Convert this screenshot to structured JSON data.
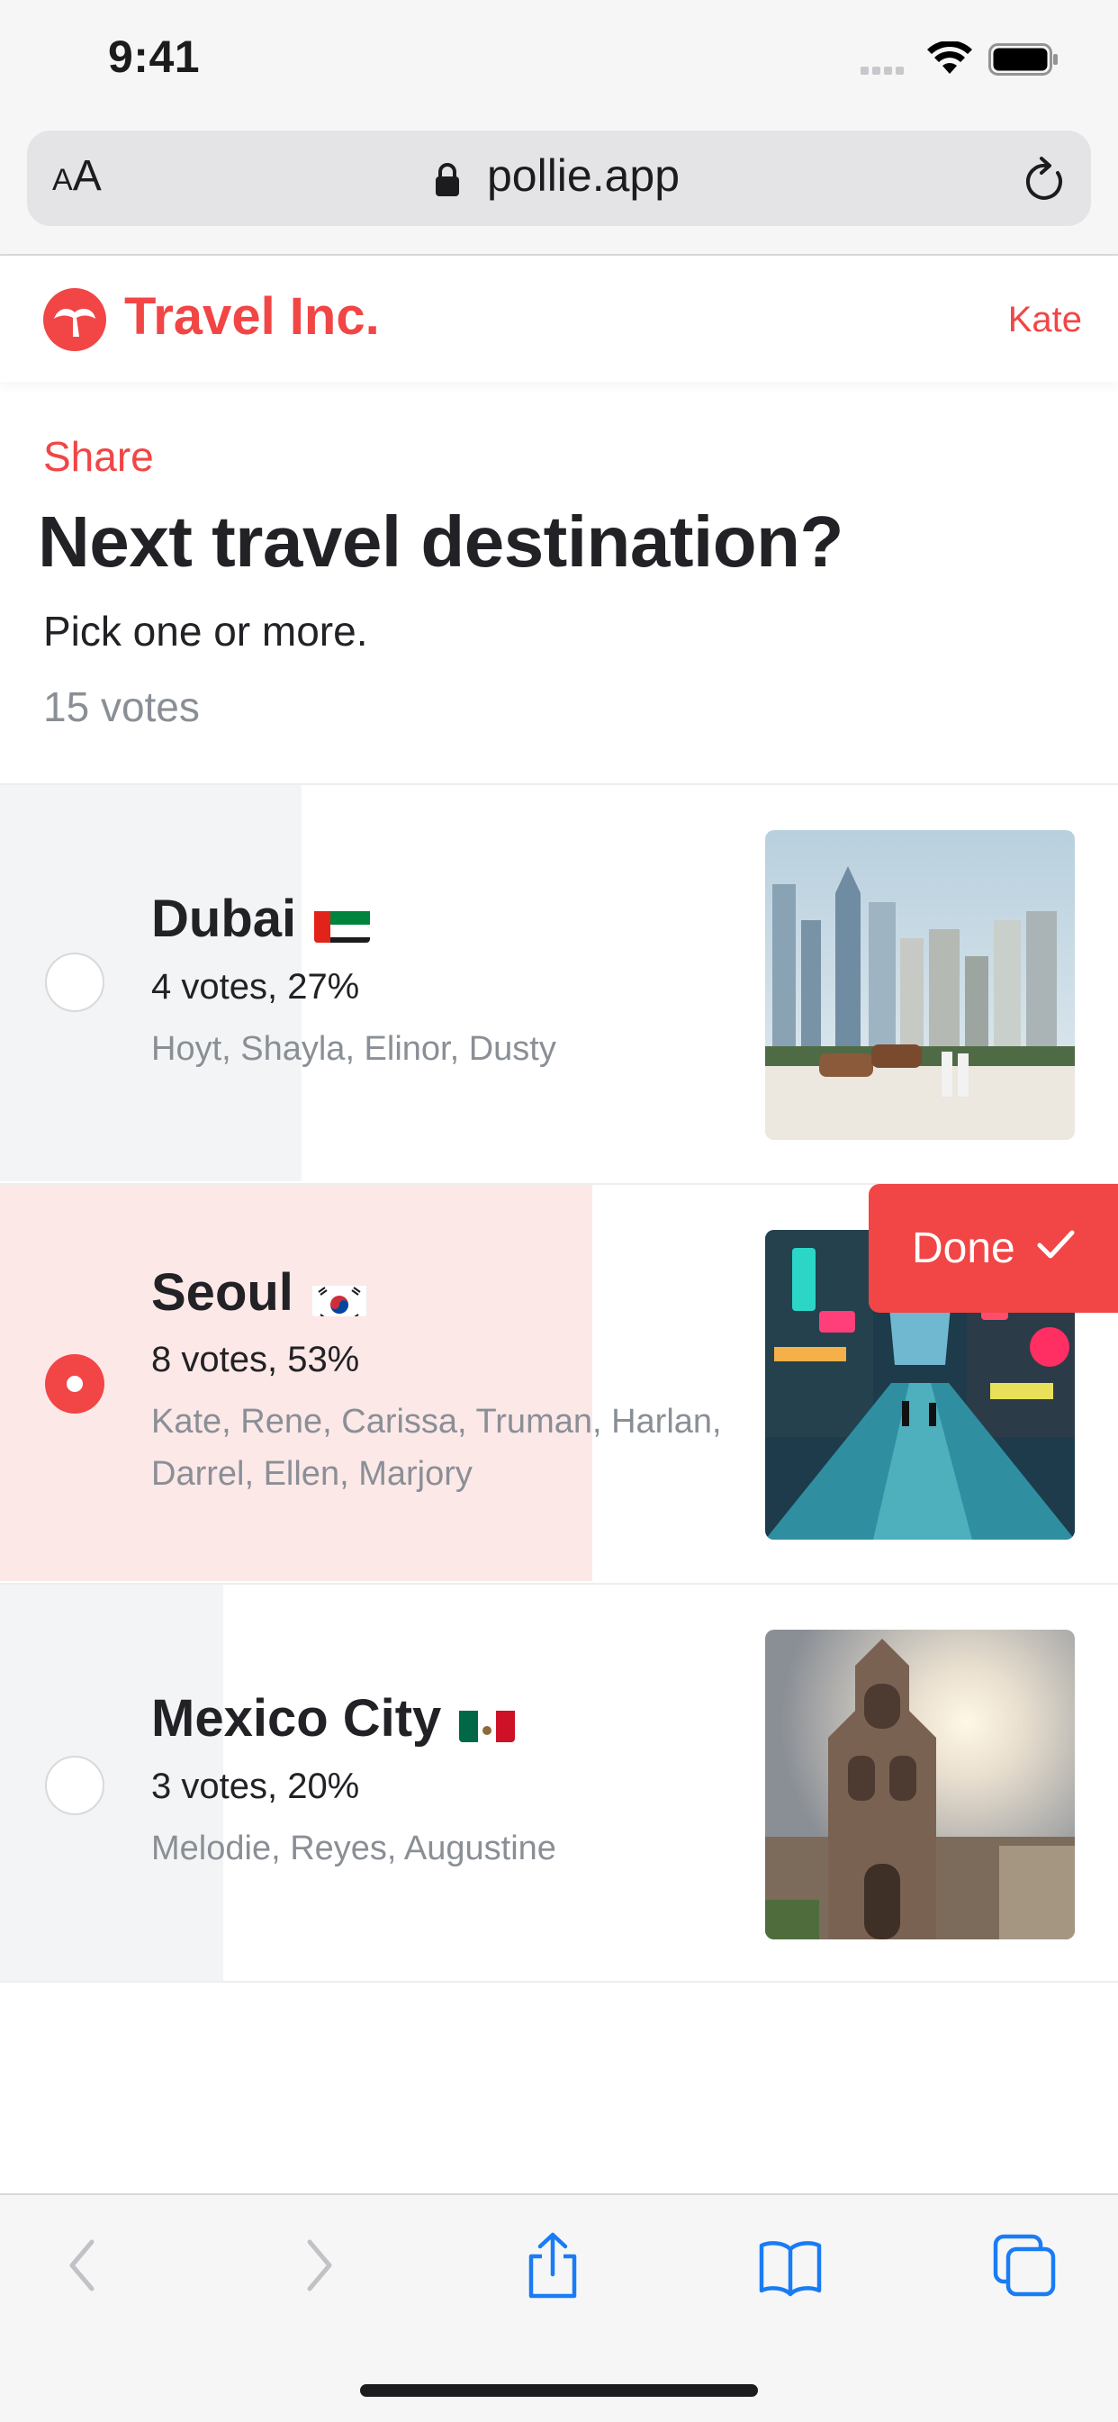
{
  "status_bar": {
    "time": "9:41"
  },
  "browser": {
    "text_size_label_small": "A",
    "text_size_label_large": "A",
    "url": "pollie.app"
  },
  "app_header": {
    "brand": "Travel Inc.",
    "user": "Kate"
  },
  "poll": {
    "share_label": "Share",
    "title": "Next travel destination?",
    "subtitle": "Pick one or more.",
    "vote_count": "15 votes",
    "options": [
      {
        "name": "Dubai",
        "flag": "united-arab-emirates-flag",
        "stats": "4 votes, 27%",
        "share": 0.27,
        "voters": "Hoyt, Shayla, Elinor, Dusty",
        "selected": false,
        "image": "dubai-skyline-with-camels-photo"
      },
      {
        "name": "Seoul",
        "flag": "south-korea-flag",
        "stats": "8 votes, 53%",
        "share": 0.53,
        "voters": "Kate, Rene, Carissa, Truman, Harlan, Darrel, Ellen, Marjory",
        "selected": true,
        "image": "seoul-neon-street-photo"
      },
      {
        "name": "Mexico City",
        "flag": "mexico-flag",
        "stats": "3 votes, 20%",
        "share": 0.2,
        "voters": "Melodie, Reyes, Augustine",
        "selected": false,
        "image": "mexico-city-cathedral-tower-photo"
      }
    ],
    "done_label": "Done"
  },
  "colors": {
    "accent": "#f24545",
    "selected_bar": "#fde8e8",
    "unselected_bar": "#f3f4f6",
    "muted_text": "#8a8f96",
    "link_blue": "#1a7cf5"
  },
  "toolbar_icons": [
    "back-arrow-icon",
    "forward-arrow-icon",
    "share-icon",
    "bookmarks-icon",
    "tabs-icon"
  ]
}
